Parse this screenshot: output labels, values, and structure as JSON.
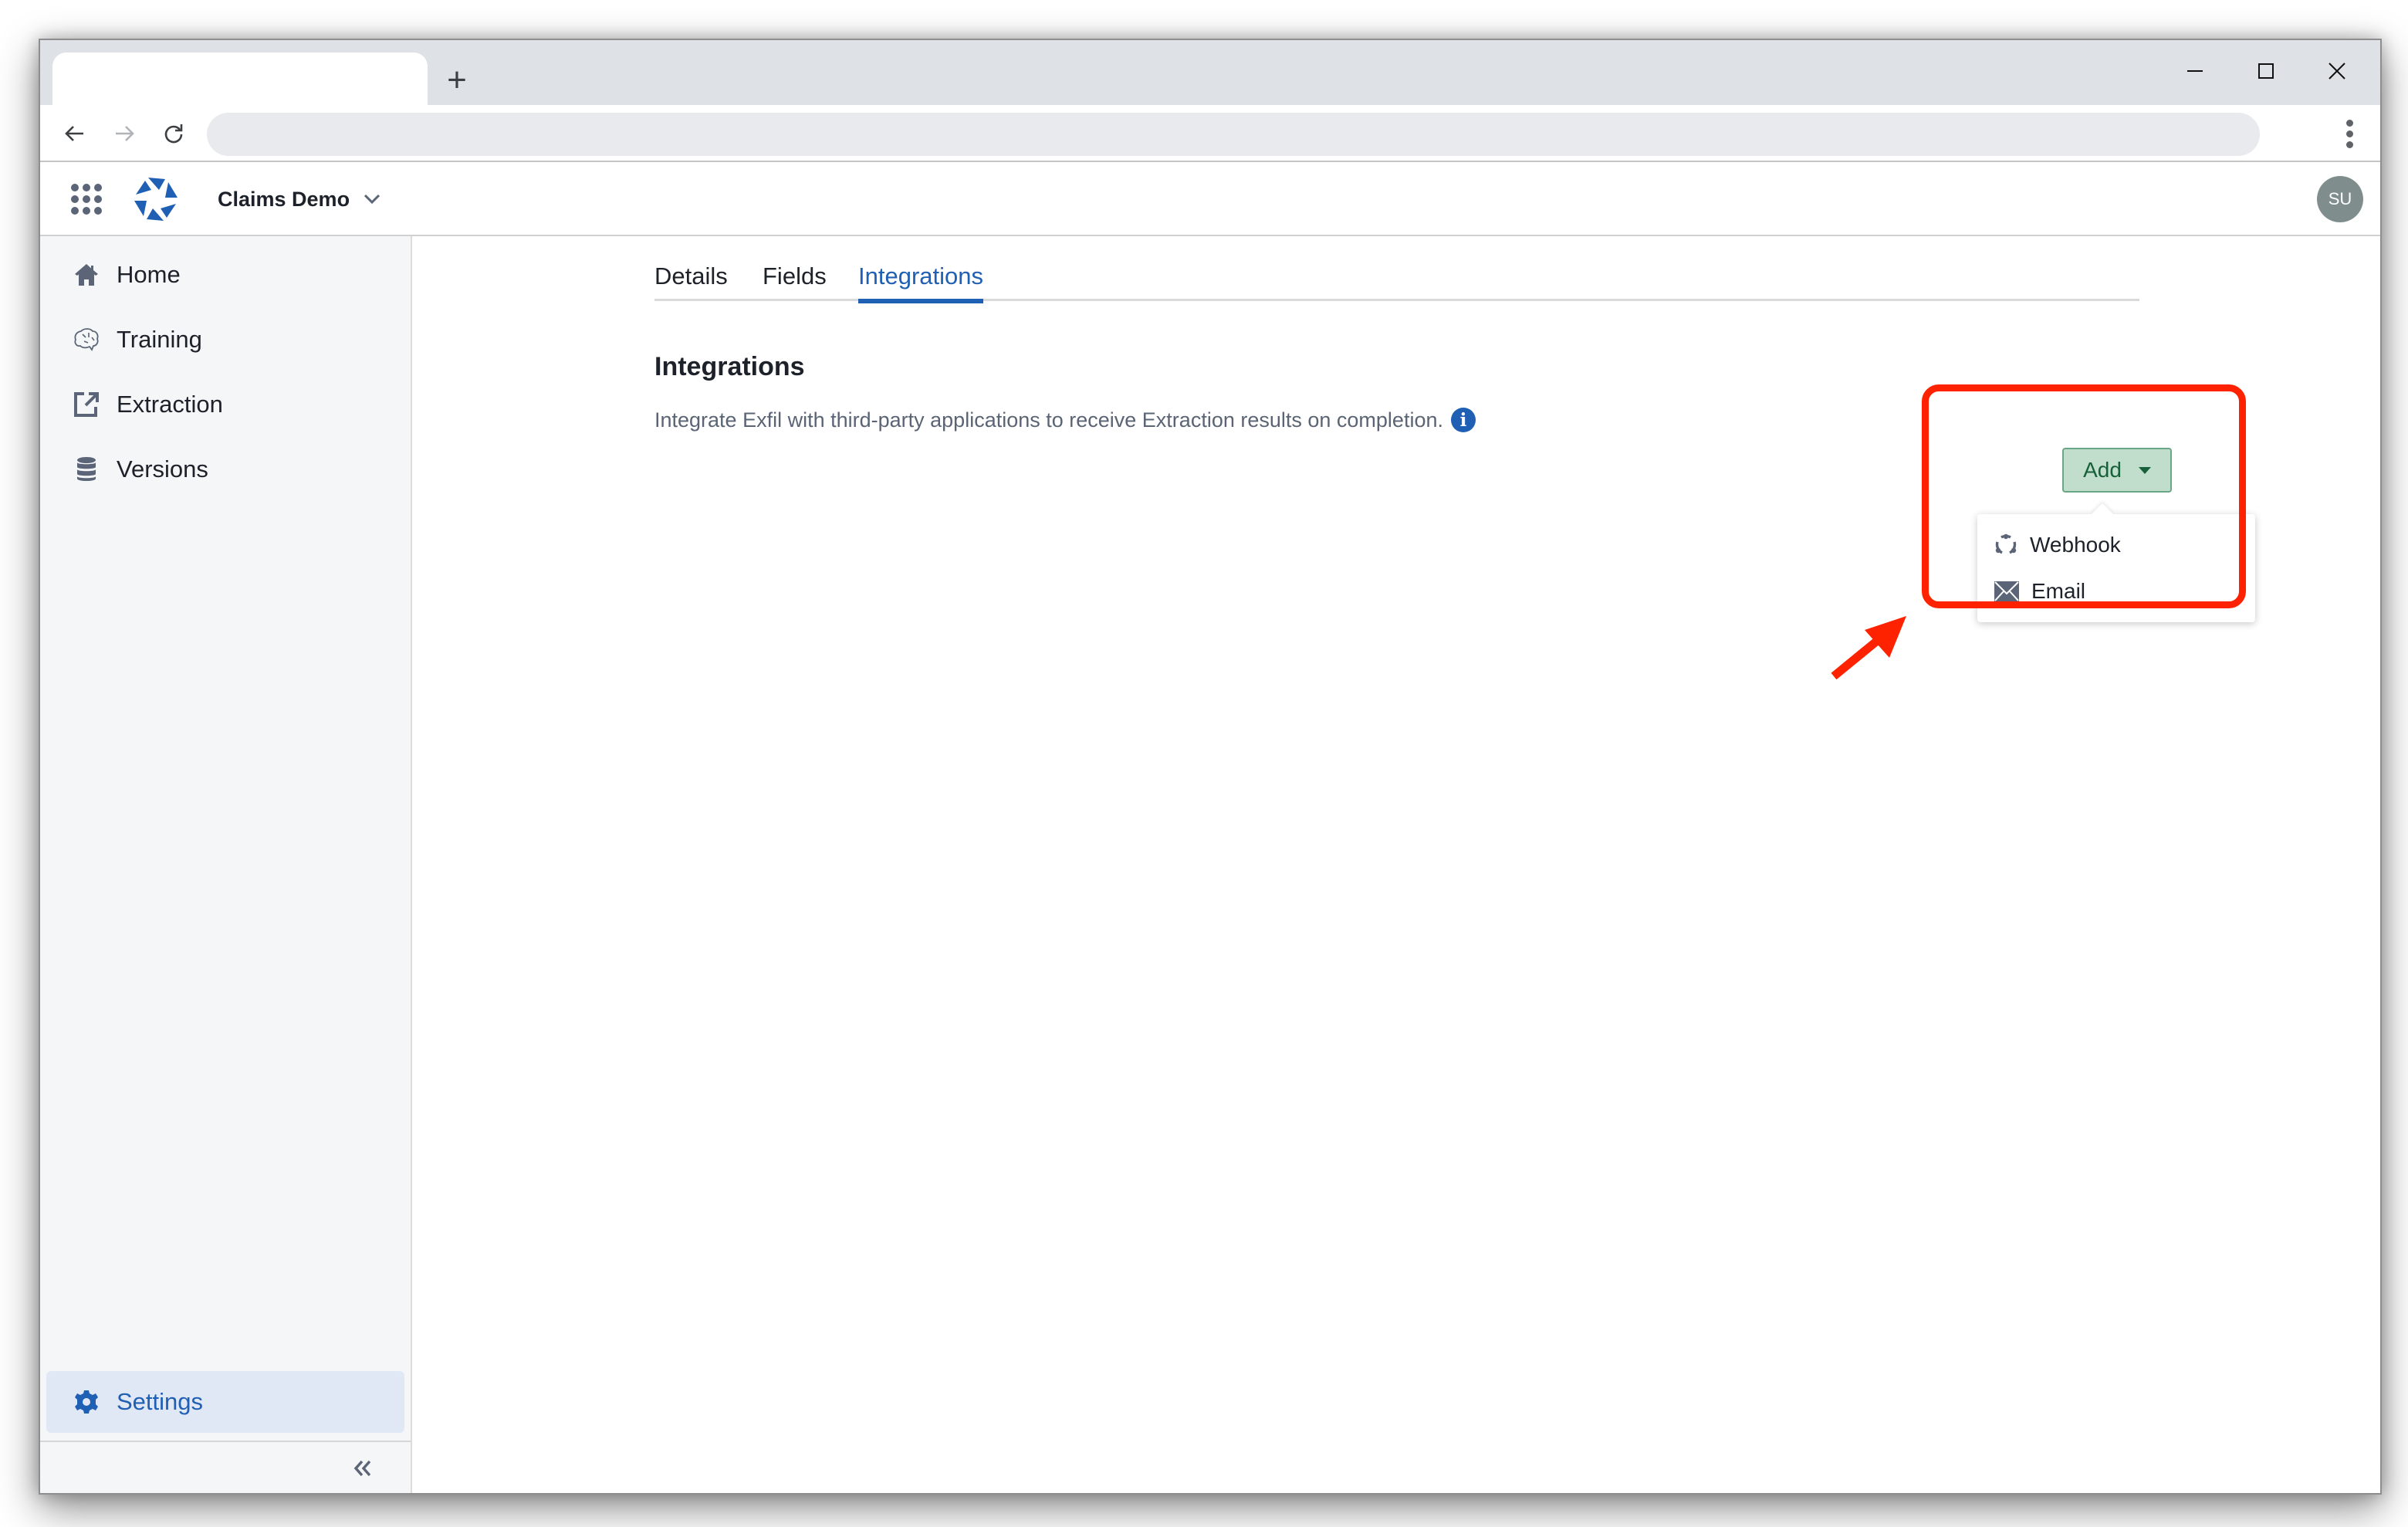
{
  "browser": {
    "tab_title": "",
    "new_tab_label": "+",
    "address_value": "",
    "window_controls": [
      "minimize-icon",
      "maximize-icon",
      "close-icon"
    ]
  },
  "header": {
    "project_name": "Claims Demo",
    "avatar_initials": "SU",
    "brand_color": "#1f5fb4",
    "avatar_color": "#7f8e8d"
  },
  "sidebar": {
    "items": [
      {
        "label": "Home",
        "icon": "home-icon"
      },
      {
        "label": "Training",
        "icon": "brain-icon"
      },
      {
        "label": "Extraction",
        "icon": "external-link-icon"
      },
      {
        "label": "Versions",
        "icon": "database-icon"
      }
    ],
    "settings": {
      "label": "Settings",
      "icon": "gear-icon",
      "active": true
    },
    "collapse_icon": "double-chevron-left-icon"
  },
  "main": {
    "tabs": [
      {
        "label": "Details",
        "active": false
      },
      {
        "label": "Fields",
        "active": false
      },
      {
        "label": "Integrations",
        "active": true
      }
    ],
    "section_title": "Integrations",
    "section_description": "Integrate Exfil with third-party applications to receive Extraction results on completion.",
    "add_button": {
      "label": "Add",
      "color": "#c1ddcc",
      "text_color": "#16613a"
    },
    "dropdown_items": [
      {
        "label": "Webhook",
        "icon": "webhook-icon"
      },
      {
        "label": "Email",
        "icon": "envelope-icon"
      }
    ]
  },
  "annotation": {
    "highlight_color": "#ff2200"
  }
}
